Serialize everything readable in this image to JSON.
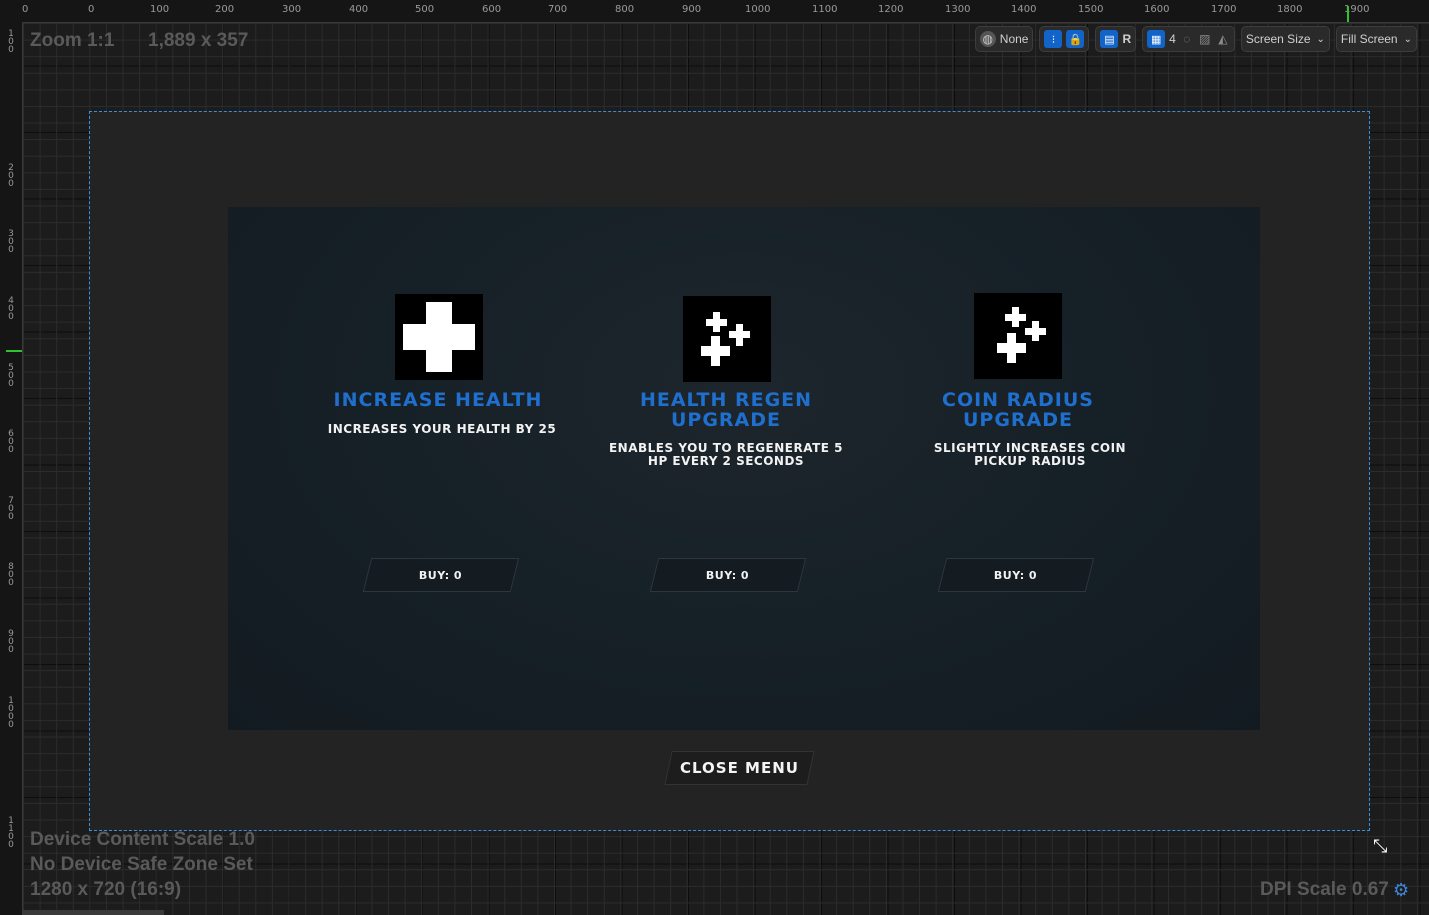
{
  "rulers": {
    "top": [
      "0",
      "0",
      "100",
      "200",
      "300",
      "400",
      "500",
      "600",
      "700",
      "800",
      "900",
      "1000",
      "1100",
      "1200",
      "1300",
      "1400",
      "1500",
      "1600",
      "1700",
      "1800",
      "1900"
    ],
    "left": [
      "100",
      "200",
      "300",
      "400",
      "500",
      "600",
      "700",
      "800",
      "900",
      "1000",
      "1100"
    ]
  },
  "viewport_info": {
    "zoom": "Zoom 1:1",
    "size": "1,889 x 357"
  },
  "toolbar": {
    "localization_label": "None",
    "r_label": "R",
    "grid_value": "4",
    "screen_size_label": "Screen Size",
    "fill_screen_label": "Fill Screen"
  },
  "upgrades": [
    {
      "title": "INCREASE HEALTH",
      "description": "INCREASES YOUR HEALTH BY 25",
      "buy_label": "BUY: 0",
      "icon": "health-cross-icon"
    },
    {
      "title": "HEALTH REGEN UPGRADE",
      "description": "ENABLES YOU TO REGENERATE 5 HP EVERY 2 SECONDS",
      "buy_label": "BUY: 0",
      "icon": "health-regen-icon"
    },
    {
      "title": "COIN RADIUS UPGRADE",
      "description": "SLIGHTLY INCREASES COIN PICKUP RADIUS",
      "buy_label": "BUY: 0",
      "icon": "coin-radius-icon"
    }
  ],
  "close_menu_label": "CLOSE MENU",
  "device_info": {
    "content_scale": "Device Content Scale 1.0",
    "safe_zone": "No Device Safe Zone Set",
    "resolution": "1280 x 720 (16:9)",
    "dpi_scale": "DPI Scale 0.67"
  },
  "colors": {
    "accent_blue": "#1f6fcf",
    "frame_border": "#3a8fd6",
    "marker_green": "#2fc42f"
  }
}
